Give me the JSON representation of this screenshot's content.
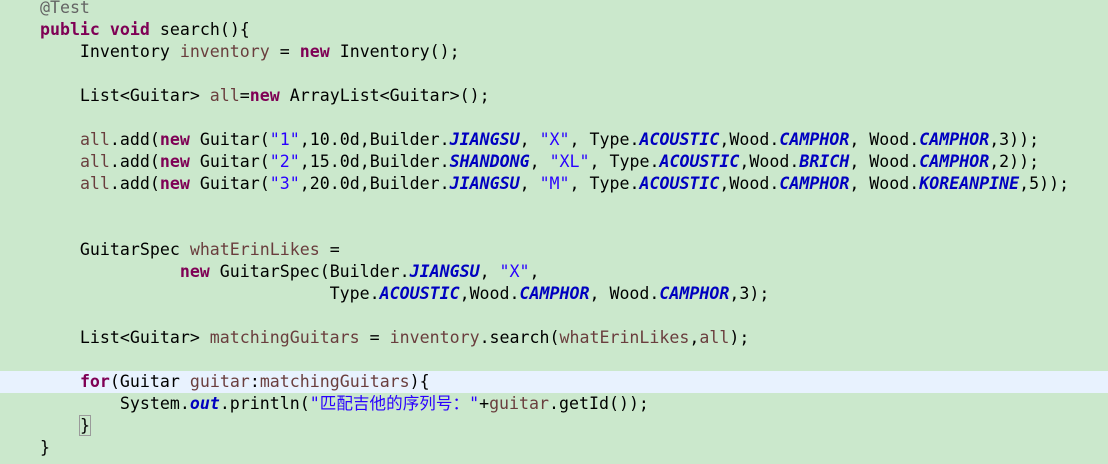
{
  "editor": {
    "background": "#cbe8cc",
    "current_line_bg": "#e8f2fe",
    "colors": {
      "keyword": "#7f0055",
      "annotation": "#646464",
      "local_variable": "#6a3e3e",
      "string": "#2a00ff",
      "static_field": "#0000c0"
    },
    "lines": [
      {
        "id": "l1",
        "tokens": [
          {
            "t": "    "
          },
          {
            "t": "@Test",
            "c": "ann"
          }
        ]
      },
      {
        "id": "l2",
        "tokens": [
          {
            "t": "    "
          },
          {
            "t": "public",
            "c": "kw"
          },
          {
            "t": " "
          },
          {
            "t": "void",
            "c": "kw"
          },
          {
            "t": " search(){"
          }
        ]
      },
      {
        "id": "l3",
        "tokens": [
          {
            "t": "        Inventory "
          },
          {
            "t": "inventory",
            "c": "var"
          },
          {
            "t": " = "
          },
          {
            "t": "new",
            "c": "kw"
          },
          {
            "t": " Inventory();"
          }
        ]
      },
      {
        "id": "l4",
        "tokens": []
      },
      {
        "id": "l5",
        "tokens": [
          {
            "t": "        List<Guitar> "
          },
          {
            "t": "all",
            "c": "var"
          },
          {
            "t": "="
          },
          {
            "t": "new",
            "c": "kw"
          },
          {
            "t": " ArrayList<Guitar>();"
          }
        ]
      },
      {
        "id": "l6",
        "tokens": []
      },
      {
        "id": "l7",
        "tokens": [
          {
            "t": "        "
          },
          {
            "t": "all",
            "c": "var"
          },
          {
            "t": ".add("
          },
          {
            "t": "new",
            "c": "kw"
          },
          {
            "t": " Guitar("
          },
          {
            "t": "\"1\"",
            "c": "str"
          },
          {
            "t": ",10.0d,Builder."
          },
          {
            "t": "JIANGSU",
            "c": "const"
          },
          {
            "t": ", "
          },
          {
            "t": "\"X\"",
            "c": "str"
          },
          {
            "t": ", Type."
          },
          {
            "t": "ACOUSTIC",
            "c": "const"
          },
          {
            "t": ",Wood."
          },
          {
            "t": "CAMPHOR",
            "c": "const"
          },
          {
            "t": ", Wood."
          },
          {
            "t": "CAMPHOR",
            "c": "const"
          },
          {
            "t": ",3));"
          }
        ]
      },
      {
        "id": "l8",
        "tokens": [
          {
            "t": "        "
          },
          {
            "t": "all",
            "c": "var"
          },
          {
            "t": ".add("
          },
          {
            "t": "new",
            "c": "kw"
          },
          {
            "t": " Guitar("
          },
          {
            "t": "\"2\"",
            "c": "str"
          },
          {
            "t": ",15.0d,Builder."
          },
          {
            "t": "SHANDONG",
            "c": "const"
          },
          {
            "t": ", "
          },
          {
            "t": "\"XL\"",
            "c": "str"
          },
          {
            "t": ", Type."
          },
          {
            "t": "ACOUSTIC",
            "c": "const"
          },
          {
            "t": ",Wood."
          },
          {
            "t": "BRICH",
            "c": "const"
          },
          {
            "t": ", Wood."
          },
          {
            "t": "CAMPHOR",
            "c": "const"
          },
          {
            "t": ",2));"
          }
        ]
      },
      {
        "id": "l9",
        "tokens": [
          {
            "t": "        "
          },
          {
            "t": "all",
            "c": "var"
          },
          {
            "t": ".add("
          },
          {
            "t": "new",
            "c": "kw"
          },
          {
            "t": " Guitar("
          },
          {
            "t": "\"3\"",
            "c": "str"
          },
          {
            "t": ",20.0d,Builder."
          },
          {
            "t": "JIANGSU",
            "c": "const"
          },
          {
            "t": ", "
          },
          {
            "t": "\"M\"",
            "c": "str"
          },
          {
            "t": ", Type."
          },
          {
            "t": "ACOUSTIC",
            "c": "const"
          },
          {
            "t": ",Wood."
          },
          {
            "t": "CAMPHOR",
            "c": "const"
          },
          {
            "t": ", Wood."
          },
          {
            "t": "KOREANPINE",
            "c": "const"
          },
          {
            "t": ",5));"
          }
        ]
      },
      {
        "id": "l10",
        "tokens": []
      },
      {
        "id": "l11",
        "tokens": []
      },
      {
        "id": "l12",
        "tokens": [
          {
            "t": "        GuitarSpec "
          },
          {
            "t": "whatErinLikes",
            "c": "var"
          },
          {
            "t": " ="
          }
        ]
      },
      {
        "id": "l13",
        "tokens": [
          {
            "t": "                  "
          },
          {
            "t": "new",
            "c": "kw"
          },
          {
            "t": " GuitarSpec(Builder."
          },
          {
            "t": "JIANGSU",
            "c": "const"
          },
          {
            "t": ", "
          },
          {
            "t": "\"X\"",
            "c": "str"
          },
          {
            "t": ","
          }
        ]
      },
      {
        "id": "l14",
        "tokens": [
          {
            "t": "                                 Type."
          },
          {
            "t": "ACOUSTIC",
            "c": "const"
          },
          {
            "t": ",Wood."
          },
          {
            "t": "CAMPHOR",
            "c": "const"
          },
          {
            "t": ", Wood."
          },
          {
            "t": "CAMPHOR",
            "c": "const"
          },
          {
            "t": ",3);"
          }
        ]
      },
      {
        "id": "l15",
        "tokens": []
      },
      {
        "id": "l16",
        "tokens": [
          {
            "t": "        List<Guitar> "
          },
          {
            "t": "matchingGuitars",
            "c": "var"
          },
          {
            "t": " = "
          },
          {
            "t": "inventory",
            "c": "var"
          },
          {
            "t": ".search("
          },
          {
            "t": "whatErinLikes",
            "c": "var"
          },
          {
            "t": ","
          },
          {
            "t": "all",
            "c": "var"
          },
          {
            "t": ");"
          }
        ]
      },
      {
        "id": "l17",
        "tokens": []
      },
      {
        "id": "l18",
        "current": true,
        "tokens": [
          {
            "t": "        "
          },
          {
            "t": "for",
            "c": "kw"
          },
          {
            "t": "(Guitar "
          },
          {
            "t": "guitar",
            "c": "var"
          },
          {
            "t": ":"
          },
          {
            "t": "matchingGuitars",
            "c": "var"
          },
          {
            "t": "){"
          }
        ]
      },
      {
        "id": "l19",
        "tokens": [
          {
            "t": "            System."
          },
          {
            "t": "out",
            "c": "statf"
          },
          {
            "t": ".println("
          },
          {
            "t": "\"匹配吉他的序列号：\"",
            "c": "str"
          },
          {
            "t": "+"
          },
          {
            "t": "guitar",
            "c": "var"
          },
          {
            "t": ".getId());"
          }
        ]
      },
      {
        "id": "l20",
        "tokens": [
          {
            "t": "        "
          },
          {
            "t": "}",
            "c": "bracket-hl"
          }
        ]
      },
      {
        "id": "l21",
        "tokens": [
          {
            "t": "    }"
          }
        ]
      }
    ]
  }
}
